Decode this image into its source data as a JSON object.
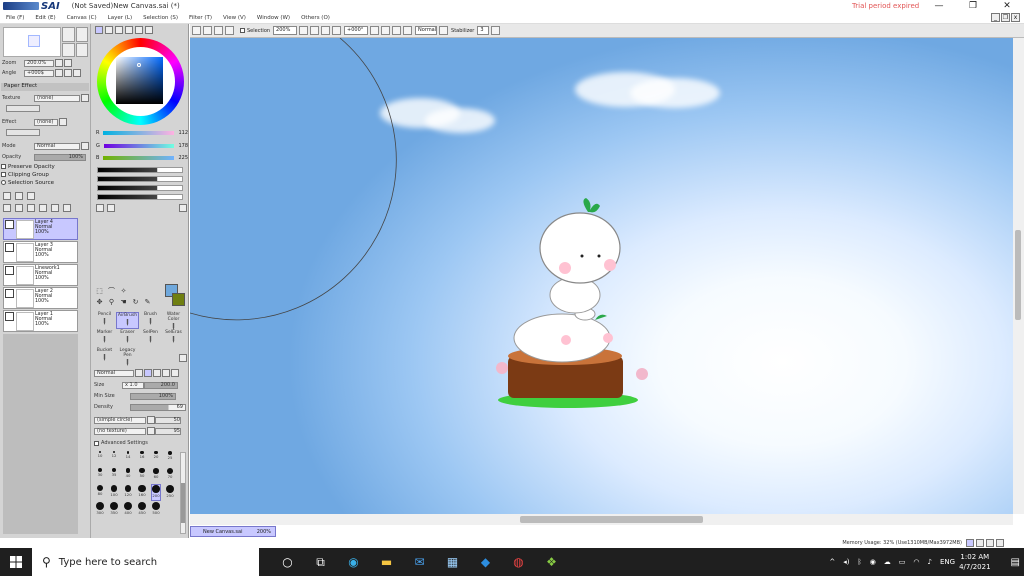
{
  "titlebar": {
    "app_name": "SAI",
    "doc_title": "(Not Saved)New Canvas.sai (*)",
    "trial": "Trial period expired"
  },
  "menu": [
    "File (F)",
    "Edit (E)",
    "Canvas (C)",
    "Layer (L)",
    "Selection (S)",
    "Filter (T)",
    "View (V)",
    "Window (W)",
    "Others (O)"
  ],
  "navigator": {
    "zoom_label": "Zoom",
    "zoom_value": "200.0%",
    "angle_label": "Angle",
    "angle_value": "+000$"
  },
  "paper": {
    "title": "Paper Effect",
    "texture_label": "Texture",
    "texture_value": "(none)",
    "effect_label": "Effect",
    "effect_value": "(none)"
  },
  "layer_props": {
    "mode_label": "Mode",
    "mode_value": "Normal",
    "opacity_label": "Opacity",
    "opacity_value": "100%",
    "preserve_opacity": "Preserve Opacity",
    "clipping_group": "Clipping Group",
    "selection_source": "Selection Source"
  },
  "layers": [
    {
      "name": "Layer 4",
      "mode": "Normal",
      "opacity": "100%",
      "selected": true
    },
    {
      "name": "Layer 3",
      "mode": "Normal",
      "opacity": "100%",
      "selected": false
    },
    {
      "name": "Linework1",
      "mode": "Normal",
      "opacity": "100%",
      "selected": false
    },
    {
      "name": "Layer 2",
      "mode": "Normal",
      "opacity": "100%",
      "selected": false
    },
    {
      "name": "Layer 1",
      "mode": "Normal",
      "opacity": "100%",
      "selected": false
    }
  ],
  "color": {
    "r_label": "R",
    "r_value": "112",
    "g_label": "G",
    "g_value": "178",
    "b_label": "B",
    "b_value": "225",
    "main": "#6fa8dc",
    "sub": "#6f7f11"
  },
  "brushes": [
    {
      "name": "Pencil",
      "selected": false
    },
    {
      "name": "AirBrush",
      "selected": true
    },
    {
      "name": "Brush",
      "selected": false
    },
    {
      "name": "Water Color",
      "selected": false
    },
    {
      "name": "Marker",
      "selected": false
    },
    {
      "name": "Eraser",
      "selected": false
    },
    {
      "name": "SelPen",
      "selected": false
    },
    {
      "name": "SelEras",
      "selected": false
    },
    {
      "name": "Bucket",
      "selected": false
    },
    {
      "name": "Legacy Pen",
      "selected": false
    }
  ],
  "brush_settings": {
    "mode": "Normal",
    "size_label": "Size",
    "size_mult": "x 1.0",
    "size_value": "200.0",
    "min_size_label": "Min Size",
    "min_size_value": "100%",
    "density_label": "Density",
    "density_value": "69",
    "shape": "(simple circle)",
    "shape_value": "50",
    "texture": "(no texture)",
    "texture_value": "95",
    "advanced": "Advanced Settings"
  },
  "brush_sizes": [
    "10",
    "12",
    "14",
    "16",
    "20",
    "25",
    "30",
    "35",
    "40",
    "50",
    "60",
    "70",
    "80",
    "100",
    "120",
    "160",
    "200",
    "250",
    "300",
    "350",
    "400",
    "450",
    "500"
  ],
  "toolbar": {
    "selection_label": "Selection",
    "zoom": "200%",
    "angle": "+000°",
    "blend": "Normal",
    "stabilizer_label": "Stabilizer",
    "stabilizer_value": "3"
  },
  "doc_tab": {
    "name": "New Canvas.sai",
    "zoom": "200%"
  },
  "status": {
    "memory": "Memory Usage: 32% (Use1310MB/Max3972MB)"
  },
  "taskbar": {
    "search_placeholder": "Type here to search",
    "lang": "ENG",
    "time": "1:02 AM",
    "date": "4/7/2021"
  }
}
